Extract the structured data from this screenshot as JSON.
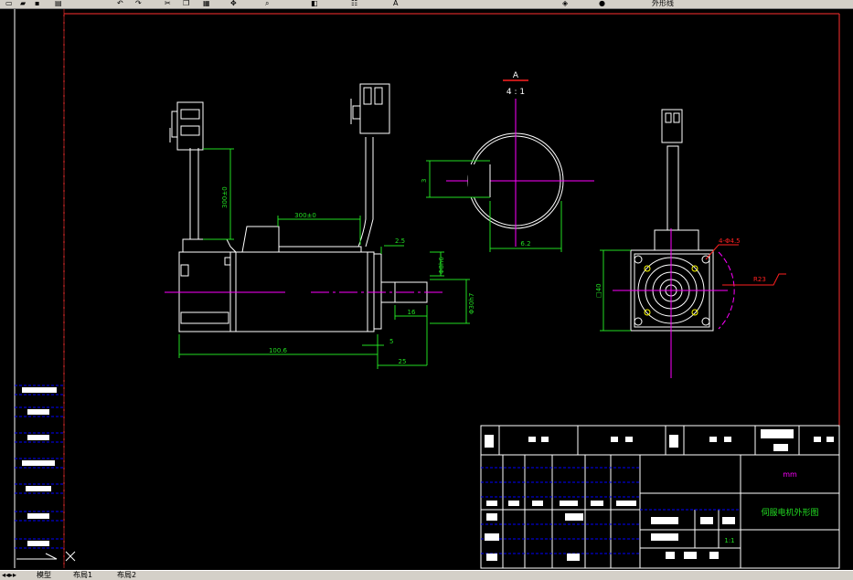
{
  "toolbar": {
    "layer_name": "外形线",
    "icons": [
      "new-icon",
      "open-icon",
      "save-icon",
      "print-icon",
      "undo-icon",
      "redo-icon",
      "cut-icon",
      "copy-icon",
      "paste-icon",
      "pan-icon",
      "zoom-icon",
      "zoom-window-icon",
      "properties-icon",
      "text-icon",
      "layer-icon",
      "color-icon"
    ]
  },
  "status": {
    "tabs": [
      "模型",
      "布局1",
      "布局2"
    ]
  },
  "drawing": {
    "colors": {
      "border": "#ff3030",
      "outline": "#ffffff",
      "dimension": "#22dd22",
      "centerline": "#ff00ff",
      "hidden": "#ffff00",
      "section": "#ff2020",
      "titleblock_dash": "#0000ff"
    },
    "dimensions": {
      "cable_length_left": "300±0",
      "cable_length_mid": "300±0",
      "flange_offset": "2.5",
      "shaft_dia": "Φ8h6",
      "pilot_dia": "Φ30h7",
      "shaft_length": "16",
      "body_length": "100.6",
      "flange_thickness": "5",
      "shaft_total": "25",
      "section_label": "A",
      "section_scale": "4 : 1",
      "key_depth": "3",
      "key_width": "6.2",
      "flange_square": "□40",
      "mounting_holes": "4-Φ4.5",
      "bolt_circle": "R23"
    },
    "title_block": {
      "unit": "mm",
      "title": "伺服电机外形图",
      "scale": "1:1"
    }
  }
}
